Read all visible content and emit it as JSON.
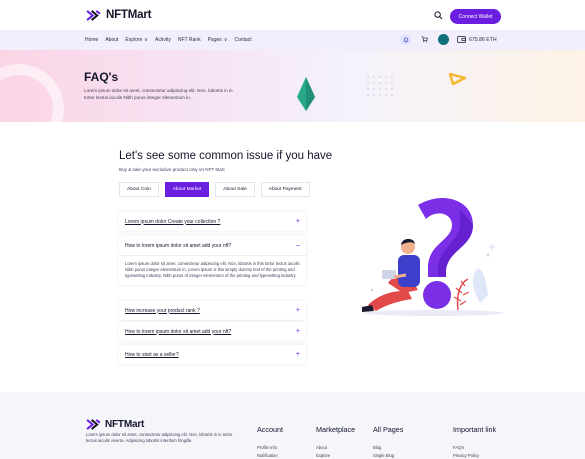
{
  "brand": {
    "name": "NFTMart"
  },
  "header": {
    "connect_label": "Connect Wallet"
  },
  "nav": {
    "items": [
      {
        "label": "Home",
        "chevron": false
      },
      {
        "label": "About",
        "chevron": false
      },
      {
        "label": "Explore",
        "chevron": true
      },
      {
        "label": "Activity",
        "chevron": false
      },
      {
        "label": "NFT Rank",
        "chevron": false
      },
      {
        "label": "Pages",
        "chevron": true
      },
      {
        "label": "Contact",
        "chevron": false
      }
    ],
    "wallet_balance": "675.86 ETH"
  },
  "hero": {
    "title": "FAQ's",
    "text": "Lorem ipsum dolor sit amet, consectetur adipiscing elit. Non, lobortis in in tortor lectus iaculis Nibh purus integer elementum in."
  },
  "faq": {
    "title": "Let's see some common issue if you have",
    "subtitle": "Buy & sale your exclusive product only on NFT Mart",
    "tabs": [
      "About Coin",
      "About Market",
      "About Sale",
      "About Payment"
    ],
    "active_tab": 1,
    "items": [
      {
        "question": "Lorem ipsum dolor Create your collection ?",
        "expanded": false,
        "sign": "+"
      },
      {
        "question": "How to lorem ipsum dolor sit amet add your nft?",
        "expanded": true,
        "sign": "–",
        "answer": "Lorem ipsum dolor sit amet, consectetur adipiscing elit. Non, lobortis in this tortor lectus iaculis Nibh purus integer elementum in. Lorem Ipsum is this simply dummy text of the printing and typesetting industry. Nibh purus of integer elementum of the printing and typesetting industry"
      },
      {
        "question": "How increase your product rank ?",
        "expanded": false,
        "sign": "+"
      },
      {
        "question": "How to lorem ipsum dolor sit amet add your nft?",
        "expanded": false,
        "sign": "+"
      },
      {
        "question": "How to start as a seller?",
        "expanded": false,
        "sign": "+"
      }
    ]
  },
  "footer": {
    "text": "Lorem ipsum dolor sit amet, consectetur adipiscing elit. Non, lobortis in in tortor lectus iaculis viverra. Adipiscing lobortis interdum fringilla",
    "columns": [
      {
        "title": "Account",
        "links": [
          "Profile Info",
          "Notification"
        ]
      },
      {
        "title": "Marketplace",
        "links": [
          "About",
          "Explore"
        ]
      },
      {
        "title": "All Pages",
        "links": [
          "Blog",
          "Single Blog"
        ]
      },
      {
        "title": "Important link",
        "links": [
          "FAQ's",
          "Privacy Policy"
        ]
      }
    ]
  },
  "colors": {
    "accent": "#6b1de0",
    "hero_gem": "#27a88a",
    "hero_triangle": "#f3b52c"
  }
}
